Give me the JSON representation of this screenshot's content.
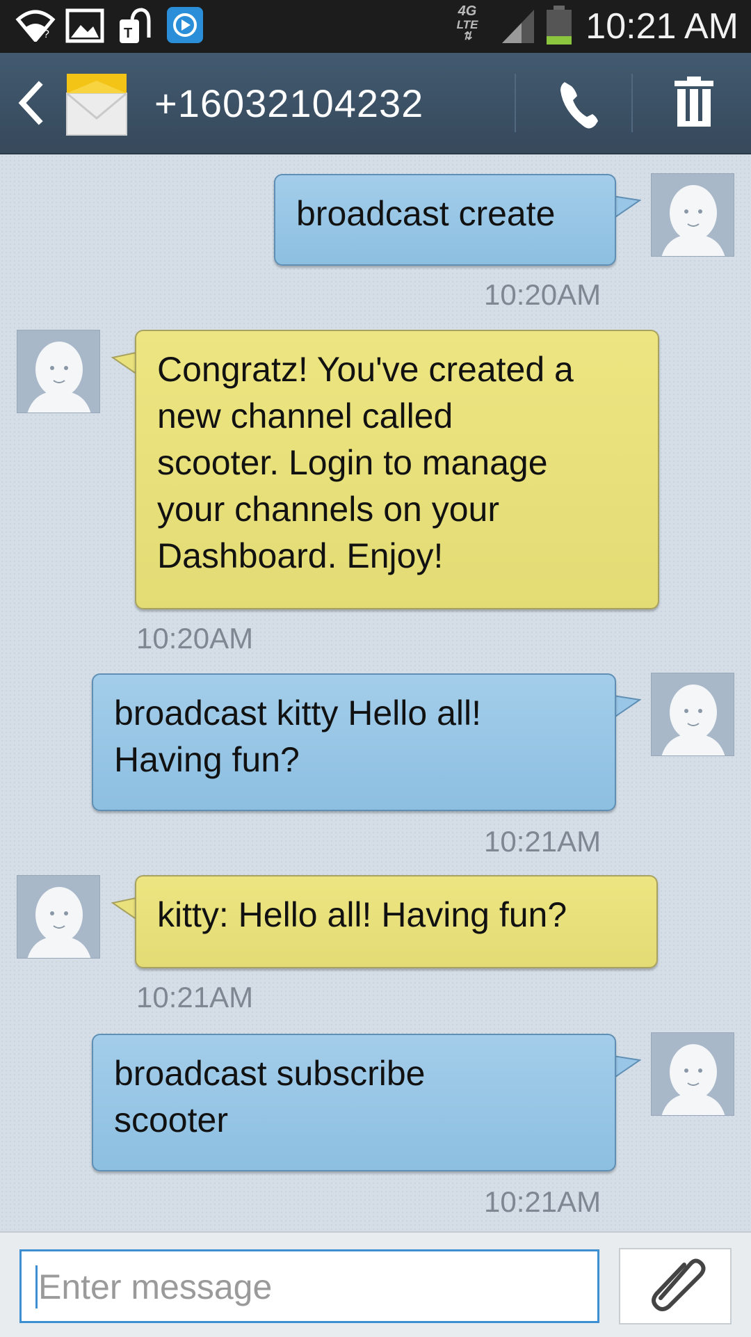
{
  "status_bar": {
    "clock": "10:21 AM",
    "network_badge_top": "4G",
    "network_badge_bottom": "LTE",
    "icons": [
      "wifi-icon",
      "gallery-icon",
      "tmobile-icon",
      "media-icon",
      "signal-icon",
      "battery-icon"
    ]
  },
  "header": {
    "contact": "+16032104232",
    "icons": [
      "back-icon",
      "envelope-icon",
      "phone-icon",
      "trash-icon"
    ]
  },
  "messages": [
    {
      "direction": "outgoing",
      "text": "broadcast create",
      "time": "10:20AM"
    },
    {
      "direction": "incoming",
      "lines": [
        "Congratz! You've created a",
        "new channel called",
        "scooter. Login to manage",
        "your channels on your",
        "Dashboard. Enjoy!"
      ],
      "time": "10:20AM"
    },
    {
      "direction": "outgoing",
      "lines": [
        "broadcast kitty Hello all!",
        "Having fun?"
      ],
      "time": "10:21AM"
    },
    {
      "direction": "incoming",
      "text": "kitty:  Hello all! Having fun?",
      "time": "10:21AM"
    },
    {
      "direction": "outgoing",
      "lines": [
        "broadcast subscribe",
        "scooter"
      ],
      "time": "10:21AM"
    }
  ],
  "compose": {
    "placeholder": "Enter message",
    "attach_icon": "paperclip-icon"
  },
  "colors": {
    "outgoing_bubble": "#8dbfe1",
    "incoming_bubble": "#e3db74",
    "action_bar": "#3d5164",
    "input_focus": "#3d8fd1"
  }
}
